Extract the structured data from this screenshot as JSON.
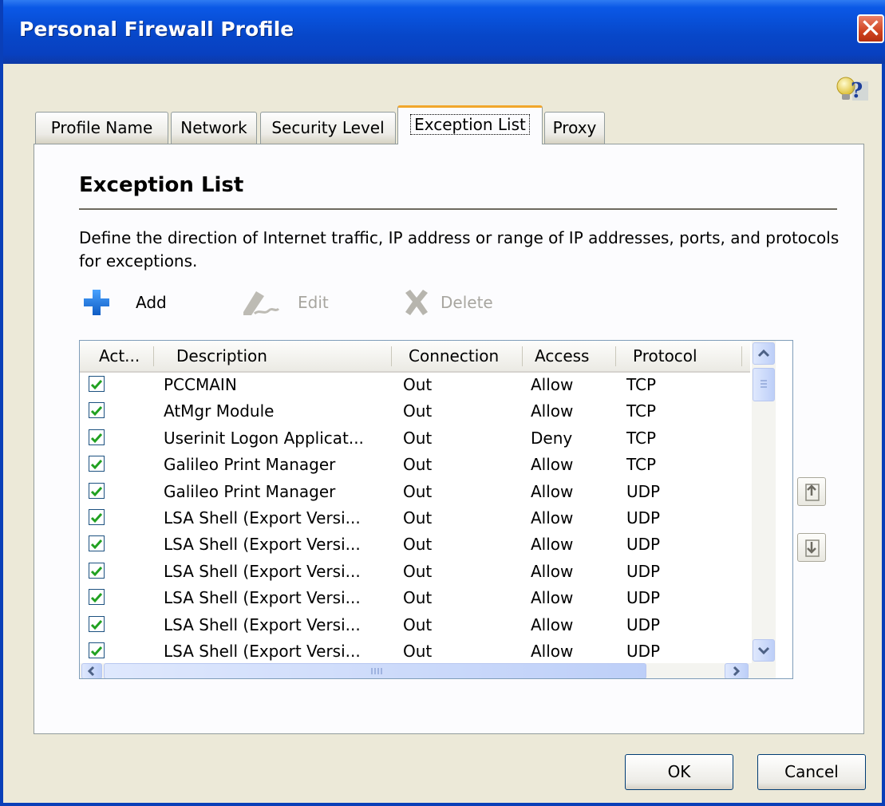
{
  "window": {
    "title": "Personal Firewall Profile",
    "close_glyph": "✕"
  },
  "help": {
    "icon": "help-bulb-icon",
    "label": "?"
  },
  "tabs": [
    {
      "label": "Profile Name"
    },
    {
      "label": "Network"
    },
    {
      "label": "Security Level"
    },
    {
      "label": "Exception List"
    },
    {
      "label": "Proxy"
    }
  ],
  "section": {
    "title": "Exception List",
    "description": "Define the direction of Internet traffic, IP address or range of IP addresses, ports, and protocols for exceptions."
  },
  "toolbar": {
    "add_label": "Add",
    "edit_label": "Edit",
    "delete_label": "Delete"
  },
  "list": {
    "columns": [
      "Act...",
      "Description",
      "Connection",
      "Access",
      "Protocol"
    ],
    "rows": [
      {
        "checked": true,
        "description": "PCCMAIN",
        "connection": "Out",
        "access": "Allow",
        "protocol": "TCP"
      },
      {
        "checked": true,
        "description": "AtMgr Module",
        "connection": "Out",
        "access": "Allow",
        "protocol": "TCP"
      },
      {
        "checked": true,
        "description": "Userinit Logon Applicat...",
        "connection": "Out",
        "access": "Deny",
        "protocol": "TCP"
      },
      {
        "checked": true,
        "description": "Galileo Print Manager",
        "connection": "Out",
        "access": "Allow",
        "protocol": "TCP"
      },
      {
        "checked": true,
        "description": "Galileo Print Manager",
        "connection": "Out",
        "access": "Allow",
        "protocol": "UDP"
      },
      {
        "checked": true,
        "description": "LSA Shell (Export Versi...",
        "connection": "Out",
        "access": "Allow",
        "protocol": "UDP"
      },
      {
        "checked": true,
        "description": "LSA Shell (Export Versi...",
        "connection": "Out",
        "access": "Allow",
        "protocol": "UDP"
      },
      {
        "checked": true,
        "description": "LSA Shell (Export Versi...",
        "connection": "Out",
        "access": "Allow",
        "protocol": "UDP"
      },
      {
        "checked": true,
        "description": "LSA Shell (Export Versi...",
        "connection": "Out",
        "access": "Allow",
        "protocol": "UDP"
      },
      {
        "checked": true,
        "description": "LSA Shell (Export Versi...",
        "connection": "Out",
        "access": "Allow",
        "protocol": "UDP"
      },
      {
        "checked": true,
        "description": "LSA Shell (Export Versi...",
        "connection": "Out",
        "access": "Allow",
        "protocol": "UDP"
      }
    ]
  },
  "buttons": {
    "ok_label": "OK",
    "cancel_label": "Cancel"
  },
  "colors": {
    "titlebar": "#0747c9",
    "accent_tab": "#f1a72c",
    "check": "#21a121",
    "add_icon": "#1a6fd6"
  }
}
